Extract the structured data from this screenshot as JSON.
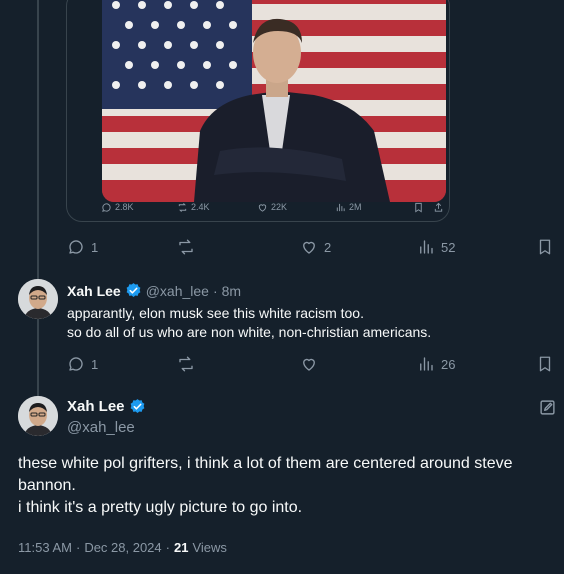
{
  "quoted_tweet": {
    "media_icon": "image-of-man-in-front-of-american-flag",
    "stats": {
      "replies": "2.8K",
      "reposts": "2.4K",
      "likes": "22K",
      "views": "2M"
    }
  },
  "first_tweet_actions": {
    "replies": "1",
    "reposts": "",
    "likes": "2",
    "views": "52"
  },
  "reply_tweet": {
    "display_name": "Xah Lee",
    "handle": "@xah_lee",
    "separator": "·",
    "time": "8m",
    "text_line1": "apparantly, elon musk see this white racism too.",
    "text_line2": "so do all of us who are non white, non-christian americans.",
    "actions": {
      "replies": "1",
      "reposts": "",
      "likes": "",
      "views": "26"
    }
  },
  "main_tweet": {
    "display_name": "Xah Lee",
    "handle": "@xah_lee",
    "text_line1": "these white pol grifters, i think a lot of them are centered around steve",
    "text_line2": "bannon.",
    "text_line3": "i think it's a pretty ugly picture to go into.",
    "time": "11:53 AM",
    "date": "Dec 28, 2024",
    "views_count": "21",
    "views_label": "Views",
    "dot": "·"
  },
  "colors": {
    "background": "#15202b",
    "text": "#f7f9f9",
    "muted": "#8b98a5",
    "verified": "#1d9bf0",
    "border": "#38444d"
  }
}
